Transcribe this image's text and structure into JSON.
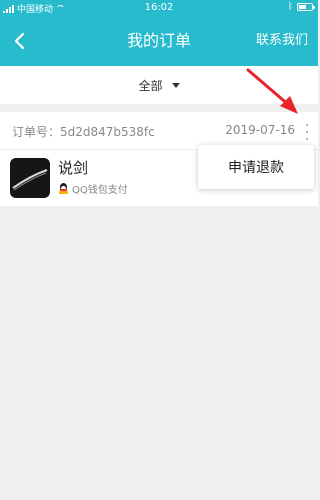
{
  "status_bar": {
    "carrier": "中国移动",
    "time": "16:02",
    "battery_level": 0.6
  },
  "header": {
    "title": "我的订单",
    "contact": "联系我们"
  },
  "filter": {
    "label": "全部"
  },
  "order": {
    "number": "订单号：5d2d847b538fc",
    "date": "2019-07-16",
    "product_name": "说剑",
    "payment_method": "QQ钱包支付"
  },
  "popup_menu": {
    "item": "申请退款"
  },
  "colors": {
    "brand": "#28bbcd",
    "annotation_arrow": "#e8232a"
  }
}
